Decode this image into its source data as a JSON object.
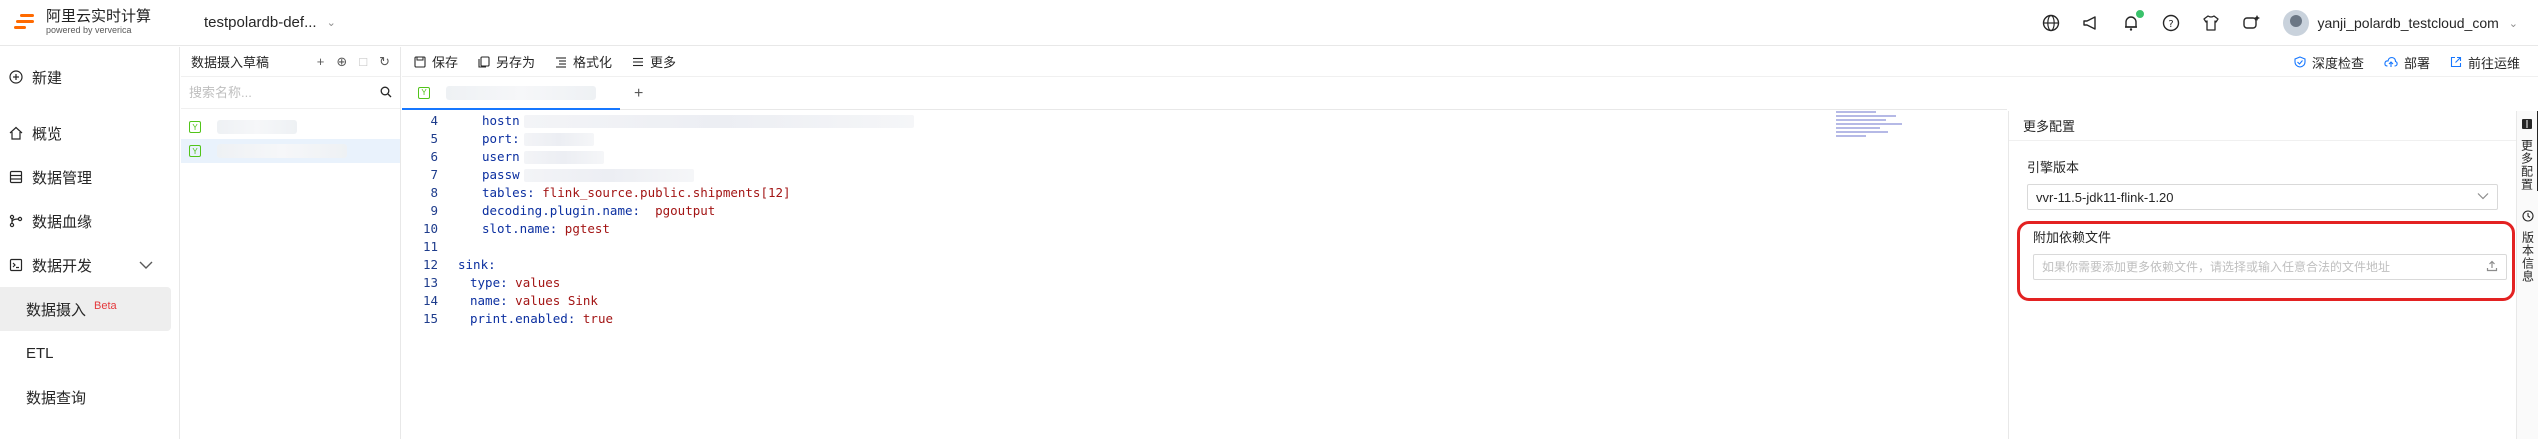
{
  "header": {
    "brand_title": "阿里云实时计算",
    "brand_sub": "powered by ververica",
    "workspace": "testpolardb-def...",
    "user_name": "yanji_polardb_testcloud_com"
  },
  "sidebar": {
    "items": [
      {
        "label": "新建",
        "icon": "plus-circle-icon"
      },
      {
        "label": "概览",
        "icon": "home-icon"
      },
      {
        "label": "数据管理",
        "icon": "database-icon"
      },
      {
        "label": "数据血缘",
        "icon": "lineage-icon"
      },
      {
        "label": "数据开发",
        "icon": "code-icon"
      },
      {
        "label": "数据摄入",
        "badge": "Beta"
      },
      {
        "label": "ETL"
      },
      {
        "label": "数据查询"
      }
    ]
  },
  "drafts": {
    "title": "数据摄入草稿",
    "search_placeholder": "搜索名称..."
  },
  "toolbar": {
    "save": "保存",
    "save_as": "另存为",
    "format": "格式化",
    "more": "更多",
    "deep_check": "深度检查",
    "deploy": "部署",
    "goto_ops": "前往运维"
  },
  "editor": {
    "lines": [
      {
        "n": "4",
        "key": "hostn",
        "masked": true
      },
      {
        "n": "5",
        "key": "port:",
        "masked": true
      },
      {
        "n": "6",
        "key": "usern",
        "masked": true
      },
      {
        "n": "7",
        "key": "passw",
        "masked": true
      },
      {
        "n": "8",
        "key": "tables:",
        "value": "flink_source.public.shipments[12]"
      },
      {
        "n": "9",
        "key": "decoding.plugin.name:",
        "value": " pgoutput"
      },
      {
        "n": "10",
        "key": "slot.name:",
        "value": "pgtest"
      },
      {
        "n": "11",
        "key": "",
        "value": ""
      },
      {
        "n": "12",
        "key": "sink:",
        "value": "",
        "indent": 0
      },
      {
        "n": "13",
        "key": "type:",
        "value": "values",
        "indent": 1
      },
      {
        "n": "14",
        "key": "name:",
        "value": "values Sink",
        "indent": 1
      },
      {
        "n": "15",
        "key": "print.enabled:",
        "value": "true",
        "indent": 1
      }
    ]
  },
  "right_panel": {
    "title": "更多配置",
    "engine_label": "引擎版本",
    "engine_value": "vvr-11.5-jdk11-flink-1.20",
    "dep_label": "附加依赖文件",
    "dep_placeholder": "如果你需要添加更多依赖文件，请选择或输入任意合法的文件地址"
  },
  "rail": {
    "tab1": "更多配置",
    "tab2": "版本信息"
  },
  "colors": {
    "accent": "#1677ff",
    "brand": "#ff6a00",
    "highlight_border": "#e32222"
  }
}
